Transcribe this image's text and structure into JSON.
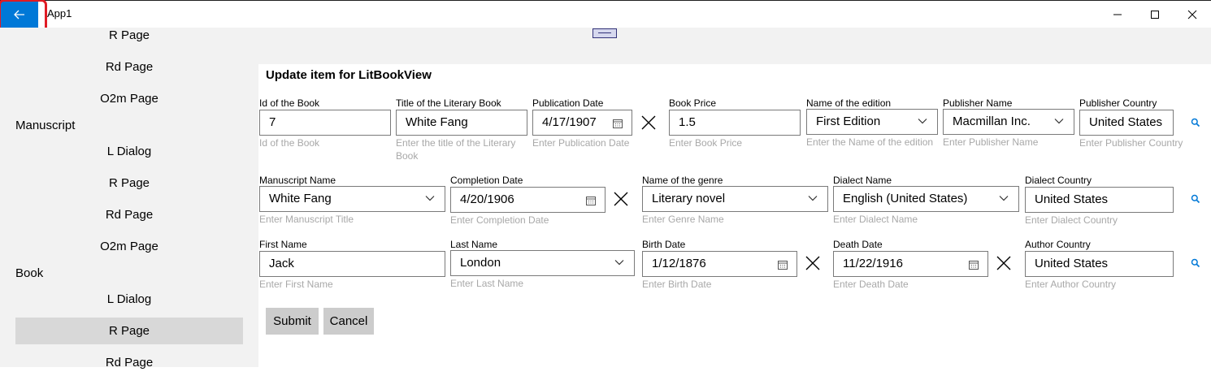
{
  "window": {
    "title": "App1"
  },
  "sidebar": {
    "top_items": [
      "R Page",
      "Rd Page",
      "O2m Page"
    ],
    "manuscript_group": "Manuscript",
    "manuscript_items": [
      "L Dialog",
      "R Page",
      "Rd Page",
      "O2m Page"
    ],
    "book_group": "Book",
    "book_items": [
      "L Dialog",
      "R Page",
      "Rd Page"
    ],
    "selected": "Book / R Page"
  },
  "form": {
    "title": "Update item for LitBookView",
    "book": {
      "id": {
        "label": "Id of the Book",
        "value": "7",
        "hint": "Id of the Book"
      },
      "title": {
        "label": "Title of the Literary Book",
        "value": "White Fang",
        "hint": "Enter the title of the Literary Book"
      },
      "pub_date": {
        "label": "Publication Date",
        "value": "4/17/1907",
        "hint": "Enter Publication Date"
      },
      "price": {
        "label": "Book Price",
        "value": "1.5",
        "hint": "Enter Book Price"
      },
      "edition": {
        "label": "Name of the edition",
        "value": "First Edition",
        "hint": "Enter the Name of the edition"
      },
      "publisher": {
        "label": "Publisher Name",
        "value": "Macmillan Inc.",
        "hint": "Enter Publisher Name"
      },
      "pub_country": {
        "label": "Publisher Country",
        "value": "United States",
        "hint": "Enter Publisher Country"
      }
    },
    "manuscript": {
      "name": {
        "label": "Manuscript Name",
        "value": "White Fang",
        "hint": "Enter Manuscript Title"
      },
      "completion": {
        "label": "Completion Date",
        "value": "4/20/1906",
        "hint": "Enter Completion Date"
      },
      "genre": {
        "label": "Name of the genre",
        "value": "Literary novel",
        "hint": "Enter Genre Name"
      },
      "dialect": {
        "label": "Dialect Name",
        "value": "English (United States)",
        "hint": "Enter Dialect Name"
      },
      "dialect_country": {
        "label": "Dialect Country",
        "value": "United States",
        "hint": "Enter Dialect Country"
      }
    },
    "author": {
      "first": {
        "label": "First Name",
        "value": "Jack",
        "hint": "Enter First Name"
      },
      "last": {
        "label": "Last Name",
        "value": "London",
        "hint": "Enter Last Name"
      },
      "birth": {
        "label": "Birth Date",
        "value": "1/12/1876",
        "hint": "Enter Birth Date"
      },
      "death": {
        "label": "Death Date",
        "value": "11/22/1916",
        "hint": "Enter Death Date"
      },
      "country": {
        "label": "Author Country",
        "value": "United States",
        "hint": "Enter Author Country"
      }
    },
    "buttons": {
      "submit": "Submit",
      "cancel": "Cancel"
    }
  },
  "icons": {
    "back": "arrow-left-icon",
    "minimize": "minimize-icon",
    "maximize": "maximize-icon",
    "close": "close-icon",
    "calendar": "calendar-icon",
    "clear": "clear-x-icon",
    "search": "search-icon",
    "chevron": "chevron-down-icon"
  },
  "colors": {
    "accent": "#0078d7",
    "highlight_outline": "#e01b24",
    "sidebar_bg": "#f2f2f2",
    "selected_bg": "#d8d8d8"
  }
}
